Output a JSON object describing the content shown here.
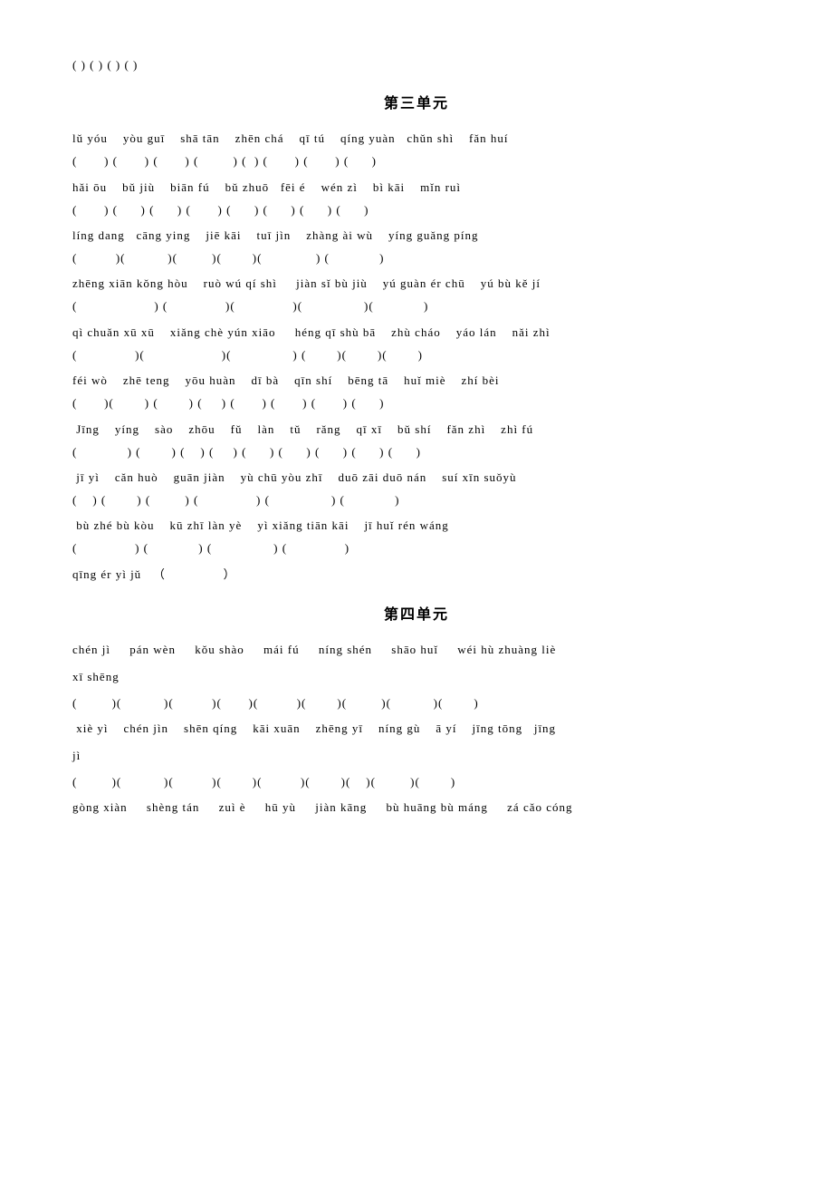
{
  "sections": [
    {
      "id": "top-brackets",
      "content": "(             ) (                   ) (                   ) (                    )"
    },
    {
      "id": "section3",
      "title": "第三单元",
      "lines": [
        {
          "pinyin": "lǔ yóu   yòu guī   shā tān   zhēn chá   qī tú   qíng yuàn  chǔn shì   fǎn huí",
          "brackets": "(       ) (       ) (       ) (         ) (  ) (       ) (       ) (      )"
        },
        {
          "pinyin": "hǎi ōu   bǔ jiù   biān fú   bǔ zhuō  fēi é   wén zì   bì kāi   mǐn ruì",
          "brackets": "(       ) (      ) (      ) (       ) (      ) (      ) (      ) (      )"
        },
        {
          "pinyin": "líng dang  cāng ying   jiē kāi   tuī jìn   zhàng ài wù   yíng guǎng píng",
          "brackets": "(          )(           )(         )(        )(              ) (             )"
        },
        {
          "pinyin": "zhēng xiān kǒng hòu   ruò wú qí shì    jiàn sǐ bù jiù   yú guàn ér chū   yú bù kě jí",
          "brackets": "(                    ) (               )(               )(                )(             )"
        },
        {
          "pinyin": "qì chuǎn xū xū   xiǎng chè yún xiāo    héng qī shù bā   zhù cháo   yáo lán   nǎi zhì",
          "brackets": "(               )(                    )(                ) (        )(        )(        )"
        },
        {
          "pinyin": "féi wò   zhē teng   yōu huàn   dī bà   qīn shí   bēng tā   huǐ miè   zhí bèi",
          "brackets": "(       )(        ) (        ) (     ) (       ) (       ) (       ) (      )"
        },
        {
          "pinyin": " Jīng   yíng   sào   zhōu   fǔ   làn   tǔ   rǎng   qī xī   bǔ shí   fǎn zhì   zhì fú",
          "brackets": "(             ) (        ) (    ) (     ) (      ) (      ) (      ) (      ) (      )"
        },
        {
          "pinyin": " jī yì   căn huò   guān jiàn   yù chū yòu zhī   duō zāi duō nán   suí xīn suǒyù",
          "brackets": "(    ) (        ) (         ) (               ) (                ) (             )"
        },
        {
          "pinyin": " bù zhé bù kòu   kū zhī làn yè   yì xiǎng tiān kāi   jī huǐ rén wáng",
          "brackets": "(               ) (             ) (                ) (               )"
        },
        {
          "pinyin": "qīng ér yì jǔ  （                ）",
          "brackets": null
        }
      ]
    },
    {
      "id": "section4",
      "title": "第四单元",
      "lines": [
        {
          "pinyin": "chén jì   pán wèn   kǒu shào   mái fú   níng shén   shāo huǐ   wéi hù zhuàng liè",
          "brackets": null
        },
        {
          "pinyin": "xī shēng",
          "brackets": null
        },
        {
          "pinyin": "(         )(           )(          )(       )(          )(        )(         )(           )(        )",
          "brackets": null
        },
        {
          "pinyin": " xiè yì   chén jìn   shēn qíng   kāi xuān   zhēng yī   níng gù   ā yí   jīng tōng  jīng",
          "brackets": null
        },
        {
          "pinyin": "jì",
          "brackets": null
        },
        {
          "pinyin": "(         )(           )(          )(        )(          )(        )(    )(         )(        )",
          "brackets": null
        },
        {
          "pinyin": "gòng xiàn   shèng tán   zuì è   hū yù   jiàn kāng   bù huāng bù máng   zá cǎo cóng",
          "brackets": null
        }
      ]
    }
  ]
}
